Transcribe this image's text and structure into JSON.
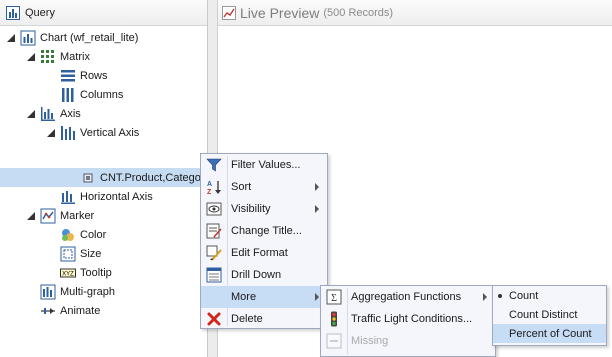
{
  "query_panel": {
    "title": "Query",
    "tree": [
      {
        "label": "Chart (wf_retail_lite)",
        "icon": "chart-icon",
        "expanded": true
      },
      {
        "label": "Matrix",
        "icon": "matrix-icon",
        "expanded": true
      },
      {
        "label": "Rows",
        "icon": "rows-icon"
      },
      {
        "label": "Columns",
        "icon": "columns-icon"
      },
      {
        "label": "Axis",
        "icon": "axis-icon",
        "expanded": true
      },
      {
        "label": "Vertical Axis",
        "icon": "vertical-axis-icon",
        "expanded": true
      },
      {
        "label": "CNT.Product,Categor",
        "icon": "field-icon",
        "selected": true
      },
      {
        "label": "Horizontal Axis",
        "icon": "horizontal-axis-icon"
      },
      {
        "label": "Marker",
        "icon": "marker-icon",
        "expanded": true
      },
      {
        "label": "Color",
        "icon": "color-icon"
      },
      {
        "label": "Size",
        "icon": "size-icon"
      },
      {
        "label": "Tooltip",
        "icon": "tooltip-icon"
      },
      {
        "label": "Multi-graph",
        "icon": "multi-graph-icon"
      },
      {
        "label": "Animate",
        "icon": "animate-icon"
      }
    ]
  },
  "preview_panel": {
    "title": "Live Preview",
    "subtitle": "(500 Records)"
  },
  "context_menu": {
    "items": [
      {
        "label": "Filter Values...",
        "icon": "funnel-icon"
      },
      {
        "label": "Sort",
        "icon": "sort-az-icon",
        "submenu": true
      },
      {
        "label": "Visibility",
        "icon": "visibility-icon",
        "submenu": true
      },
      {
        "label": "Change Title...",
        "icon": "change-title-icon"
      },
      {
        "label": "Edit Format",
        "icon": "edit-format-icon"
      },
      {
        "label": "Drill Down",
        "icon": "drill-down-icon"
      },
      {
        "label": "More",
        "icon": "",
        "submenu": true,
        "highlighted": true
      },
      {
        "label": "Delete",
        "icon": "delete-icon"
      }
    ]
  },
  "more_menu": {
    "items": [
      {
        "label": "Aggregation Functions",
        "icon": "aggregation-icon",
        "submenu": true
      },
      {
        "label": "Traffic Light Conditions...",
        "icon": "traffic-light-icon"
      },
      {
        "label": "Missing",
        "icon": "missing-icon",
        "disabled": true
      }
    ]
  },
  "aggregation_menu": {
    "items": [
      {
        "label": "Count",
        "checked": true
      },
      {
        "label": "Count Distinct"
      },
      {
        "label": "Percent of Count",
        "highlighted": true
      }
    ]
  },
  "colors": {
    "selection": "#c6dcf3",
    "menu_highlight": "#c7dcf5",
    "menu_background": "#f5f6fb",
    "icon_blue": "#2f5f9e"
  }
}
